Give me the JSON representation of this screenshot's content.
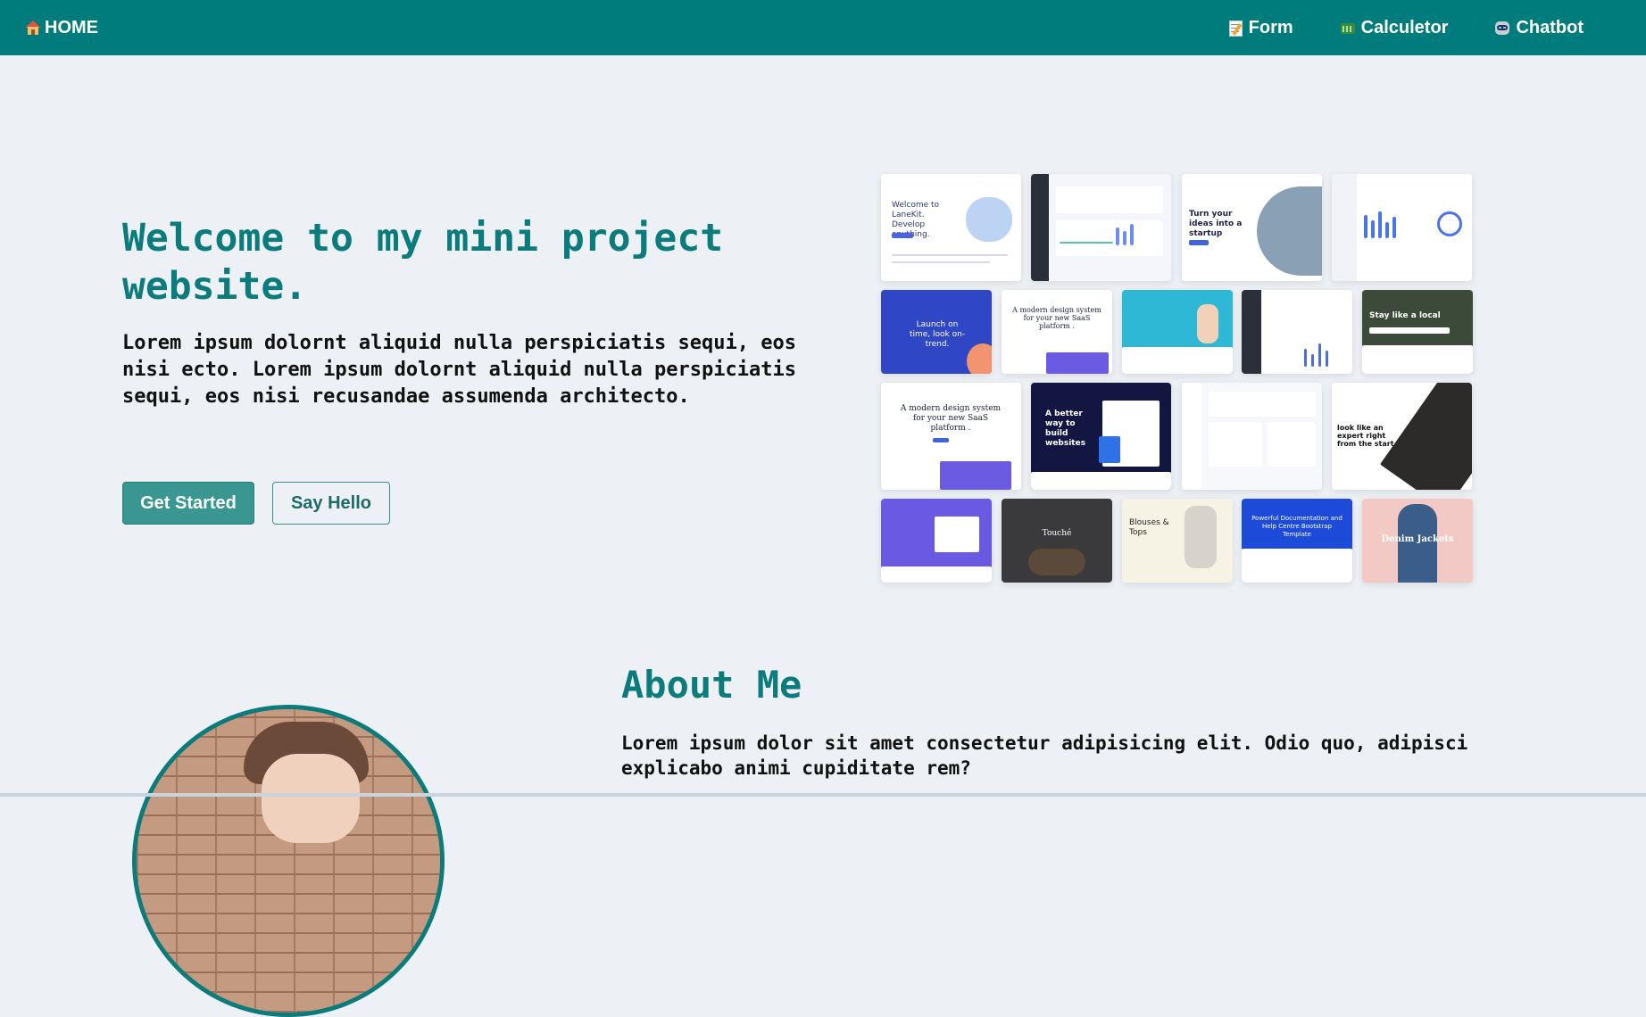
{
  "nav": {
    "home_label": "HOME",
    "links": [
      {
        "label": "Form",
        "icon": "memo-icon"
      },
      {
        "label": "Calculetor",
        "icon": "calculator-icon"
      },
      {
        "label": "Chatbot",
        "icon": "robot-icon"
      }
    ]
  },
  "hero": {
    "title": "Welcome to my mini project website.",
    "text": "Lorem ipsum dolornt aliquid nulla perspiciatis sequi, eos nisi ecto. Lorem ipsum dolornt aliquid nulla perspiciatis sequi, eos nisi recusandae assumenda architecto.",
    "primary_button": "Get Started",
    "secondary_button": "Say Hello",
    "gallery_headlines": [
      "Welcome to LaneKit. Develop anything.",
      "Turn your ideas into a startup",
      "Launch on time, look on-trend.",
      "A modern design system for your new SaaS platform .",
      "Stay like a local",
      "A modern design system for your new SaaS platform .",
      "A better way to build websites",
      "look like an expert right from the start",
      "Touché",
      "Blouses & Tops",
      "Powerful Documentation and Help Centre Bootstrap Template",
      "Denim Jackets"
    ]
  },
  "about": {
    "title": "About Me",
    "text": "Lorem ipsum dolor sit amet consectetur adipisicing elit. Odio quo, adipisci explicabo animi cupiditate rem?"
  },
  "colors": {
    "nav_bg": "#007c7c",
    "accent": "#0b7b7b",
    "primary_button": "#3a9690",
    "page_bg": "#edf1f5"
  }
}
